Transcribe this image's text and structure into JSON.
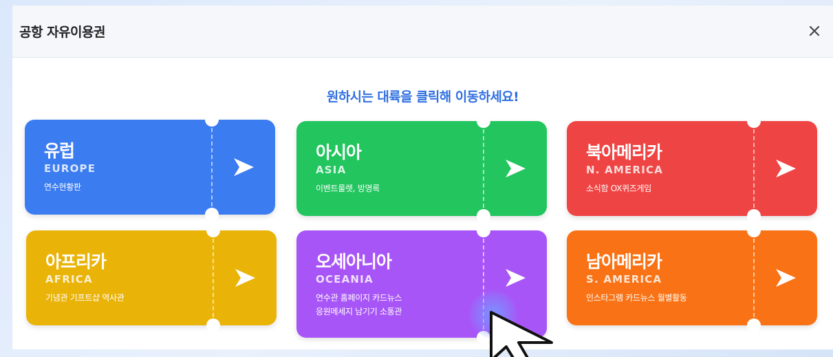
{
  "modal": {
    "title": "공항 자유이용권",
    "close_icon": "close-icon",
    "instruction": "원하시는 대륙을 클릭해 이동하세요!"
  },
  "tickets": [
    {
      "ko": "유럽",
      "en": "EUROPE",
      "desc": "연수현황판",
      "color": "#3b7cf0"
    },
    {
      "ko": "아시아",
      "en": "ASIA",
      "desc": "이벤트룰렛, 방명록",
      "color": "#22c55e"
    },
    {
      "ko": "북아메리카",
      "en": "N. AMERICA",
      "desc": "소식함 OX퀴즈게임",
      "color": "#ef4444"
    },
    {
      "ko": "아프리카",
      "en": "AFRICA",
      "desc": "기념관 기프트샵 역사관",
      "color": "#eab308"
    },
    {
      "ko": "오세아니아",
      "en": "OCEANIA",
      "desc": "연수관 홈페이지 카드뉴스\n응원메세지 남기기 소통관",
      "color": "#a855f7"
    },
    {
      "ko": "남아메리카",
      "en": "S. AMERICA",
      "desc": "인스타그램 카드뉴스 월별활동",
      "color": "#f97316"
    }
  ],
  "icons": {
    "arrow": "paper-plane-arrow-icon",
    "cursor": "mouse-pointer-icon"
  }
}
